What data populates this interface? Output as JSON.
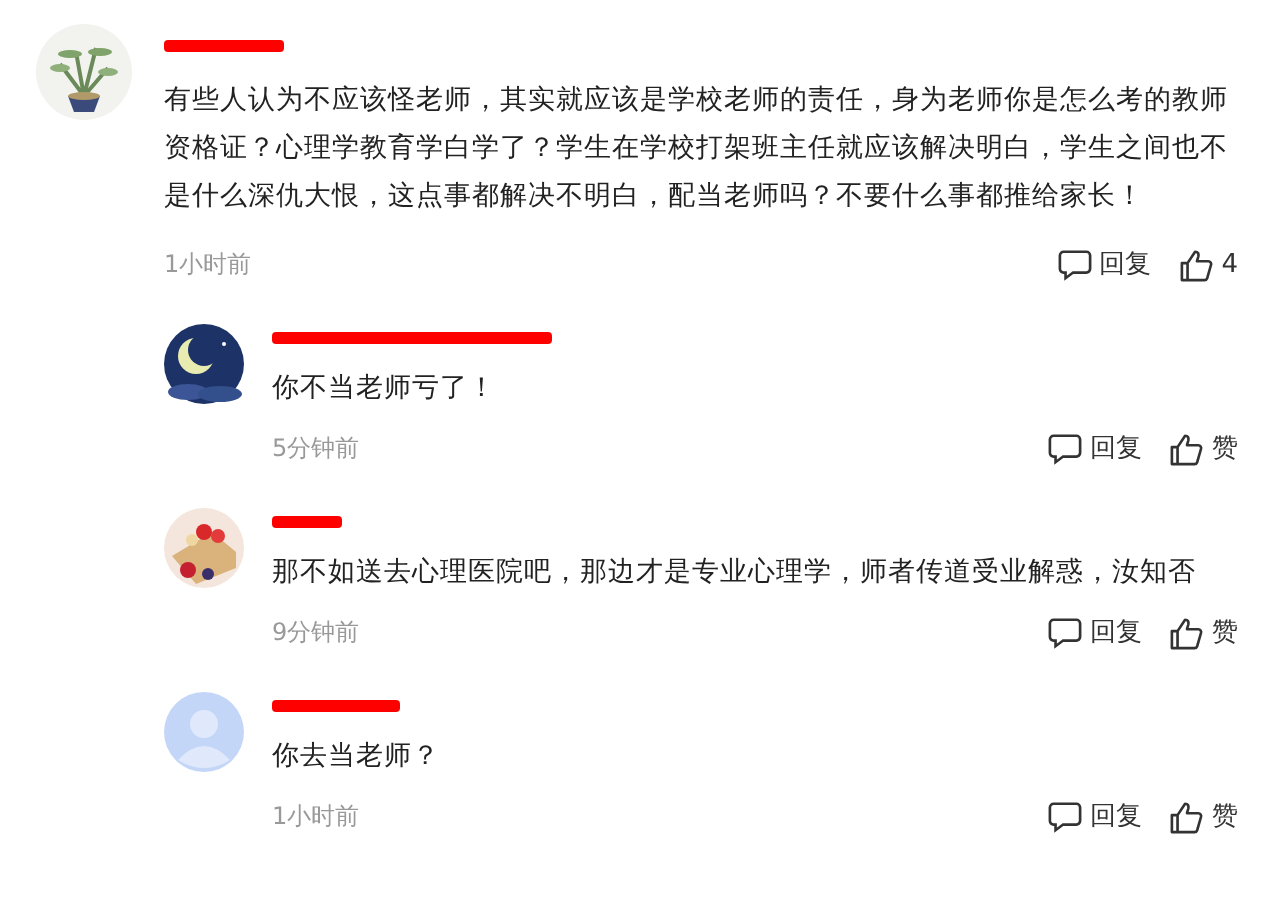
{
  "comment": {
    "text": "有些人认为不应该怪老师，其实就应该是学校老师的责任，身为老师你是怎么考的教师资格证？心理学教育学白学了？学生在学校打架班主任就应该解决明白，学生之间也不是什么深仇大恨，这点事都解决不明白，配当老师吗？不要什么事都推给家长！",
    "time": "1小时前",
    "reply": "回复",
    "like": "4",
    "replies": [
      {
        "text": "你不当老师亏了！",
        "time": "5分钟前",
        "reply": "回复",
        "like": "赞"
      },
      {
        "text": "那不如送去心理医院吧，那边才是专业心理学，师者传道受业解惑，汝知否",
        "time": "9分钟前",
        "reply": "回复",
        "like": "赞"
      },
      {
        "avatar": {
          "kind": "default"
        },
        "text": "你去当老师？",
        "time": "1小时前",
        "reply": "回复",
        "like": "赞"
      }
    ]
  }
}
